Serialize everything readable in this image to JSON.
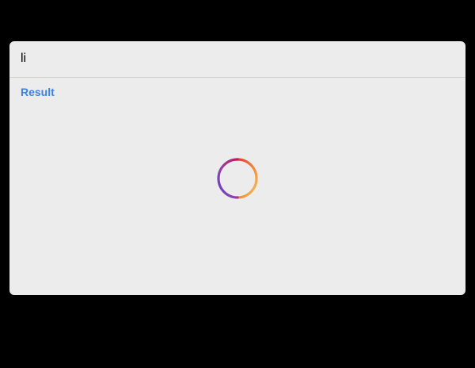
{
  "search": {
    "value": "li",
    "placeholder": ""
  },
  "results": {
    "header_label": "Result"
  },
  "loading": {
    "icon": "loading-spinner-icon",
    "gradient_colors": [
      "#e03a3a",
      "#f2a23c",
      "#f7c35b",
      "#5b3fd0",
      "#8e44ad"
    ]
  },
  "colors": {
    "background": "#000000",
    "panel": "#ececec",
    "accent": "#3b82e6",
    "divider": "#cfcfcf"
  }
}
